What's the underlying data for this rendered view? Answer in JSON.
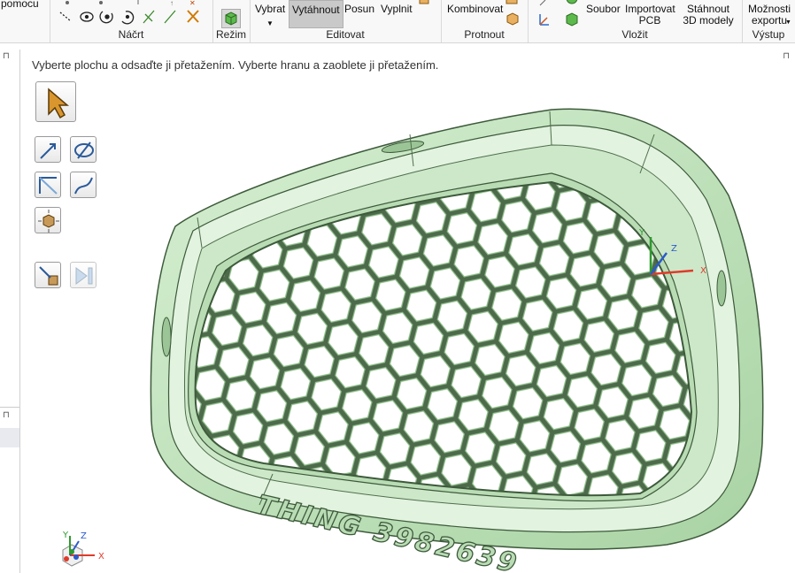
{
  "ribbon": {
    "partial_top_left": "pomocu",
    "groups": {
      "sketch": {
        "label": "Náčrt"
      },
      "mode": {
        "label": "Režim",
        "button": "Režim"
      },
      "edit": {
        "label": "Editovat",
        "buttons": [
          "Vybrat",
          "Vytáhnout",
          "Posun",
          "Vyplnit"
        ]
      },
      "intersect": {
        "label": "Protnout",
        "buttons": [
          "Kombinovat"
        ]
      },
      "insert": {
        "label": "Vložit",
        "buttons": [
          "Soubor",
          "Importovat PCB",
          "Stáhnout 3D modely"
        ]
      },
      "output": {
        "label": "Výstup",
        "buttons": [
          "Možnosti exportu"
        ]
      }
    }
  },
  "viewport": {
    "hint": "Vyberte plochu a odsaďte ji přetažením. Vyberte hranu a zaoblete ji přetažením.",
    "embossed_text": "THING 3982639",
    "axis_labels": {
      "x": "X",
      "y": "Y",
      "z": "Z"
    }
  },
  "colors": {
    "model_fill": "#c8e6c4",
    "model_edge": "#3d5a3b",
    "ribbon_bg": "#f8f8f8",
    "active_btn": "#c9c9c9"
  }
}
